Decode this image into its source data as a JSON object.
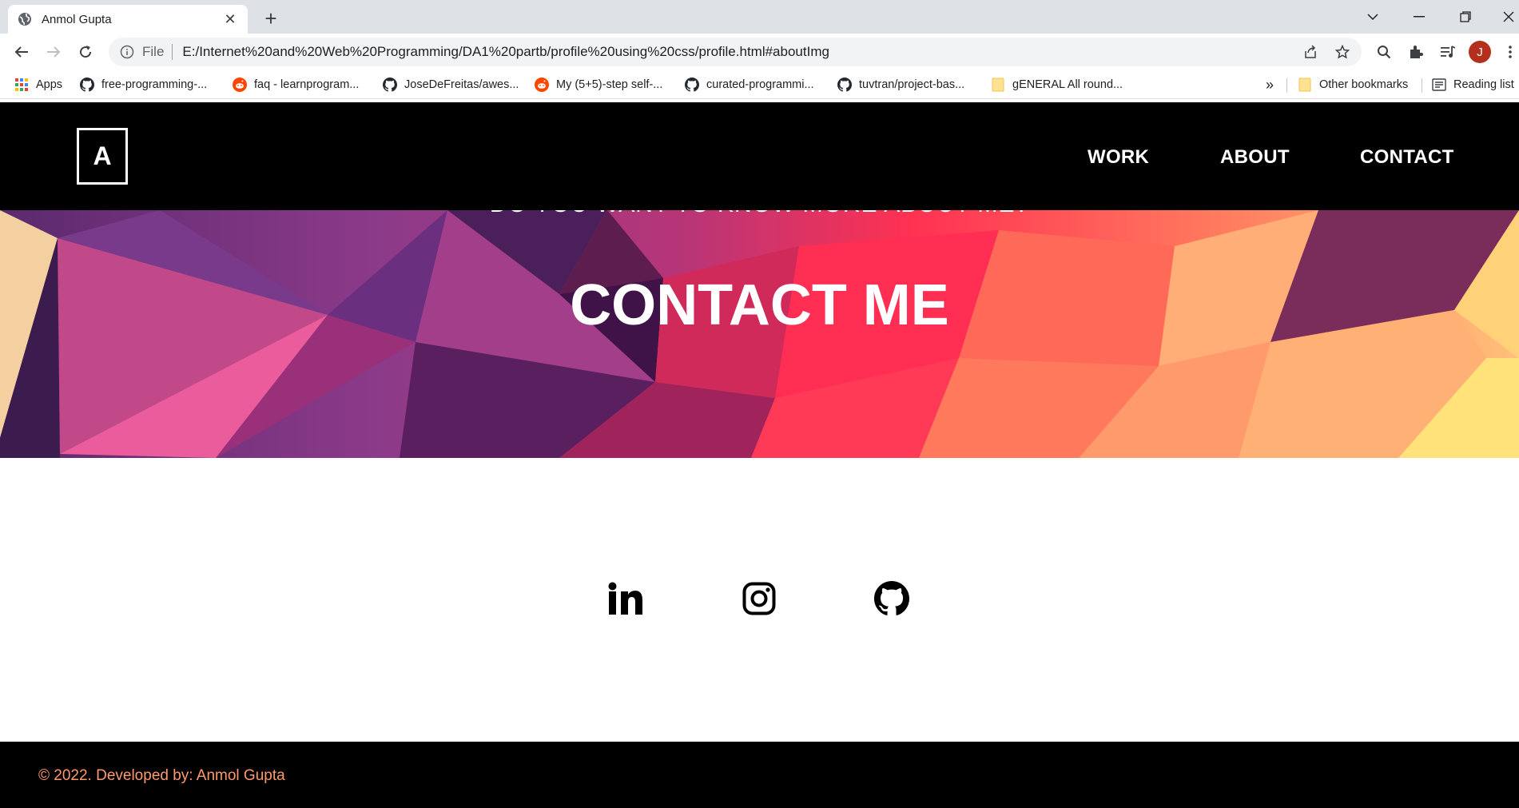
{
  "browser": {
    "tab_title": "Anmol Gupta",
    "address_scheme": "File",
    "url": "E:/Internet%20and%20Web%20Programming/DA1%20partb/profile%20using%20css/profile.html#aboutImg",
    "avatar_letter": "J"
  },
  "bookmarks": {
    "apps": "Apps",
    "items": [
      {
        "label": "free-programming-...",
        "icon": "github-icon"
      },
      {
        "label": "faq - learnprogram...",
        "icon": "reddit-icon"
      },
      {
        "label": "JoseDeFreitas/awes...",
        "icon": "github-icon"
      },
      {
        "label": "My (5+5)-step self-...",
        "icon": "reddit-icon"
      },
      {
        "label": "curated-programmi...",
        "icon": "github-icon"
      },
      {
        "label": "tuvtran/project-bas...",
        "icon": "github-icon"
      },
      {
        "label": "gENERAL All round...",
        "icon": "folder-icon"
      }
    ],
    "overflow": "»",
    "other": "Other bookmarks",
    "reading_list": "Reading list"
  },
  "site": {
    "logo": "A",
    "nav": [
      "WORK",
      "ABOUT",
      "CONTACT"
    ],
    "hero_subtitle": "DO YOU WANT TO KNOW MORE ABOUT ME?",
    "hero_title": "CONTACT ME",
    "socials": [
      "linkedin-icon",
      "instagram-icon",
      "github-icon"
    ],
    "footer": "© 2022. Developed by: Anmol Gupta"
  },
  "colors": {
    "nav_bg": "#000000",
    "footer_text": "#ff9a6c",
    "hero_purple": "#6b2a7a",
    "hero_red": "#ff3152",
    "hero_orange": "#ffad6a"
  }
}
